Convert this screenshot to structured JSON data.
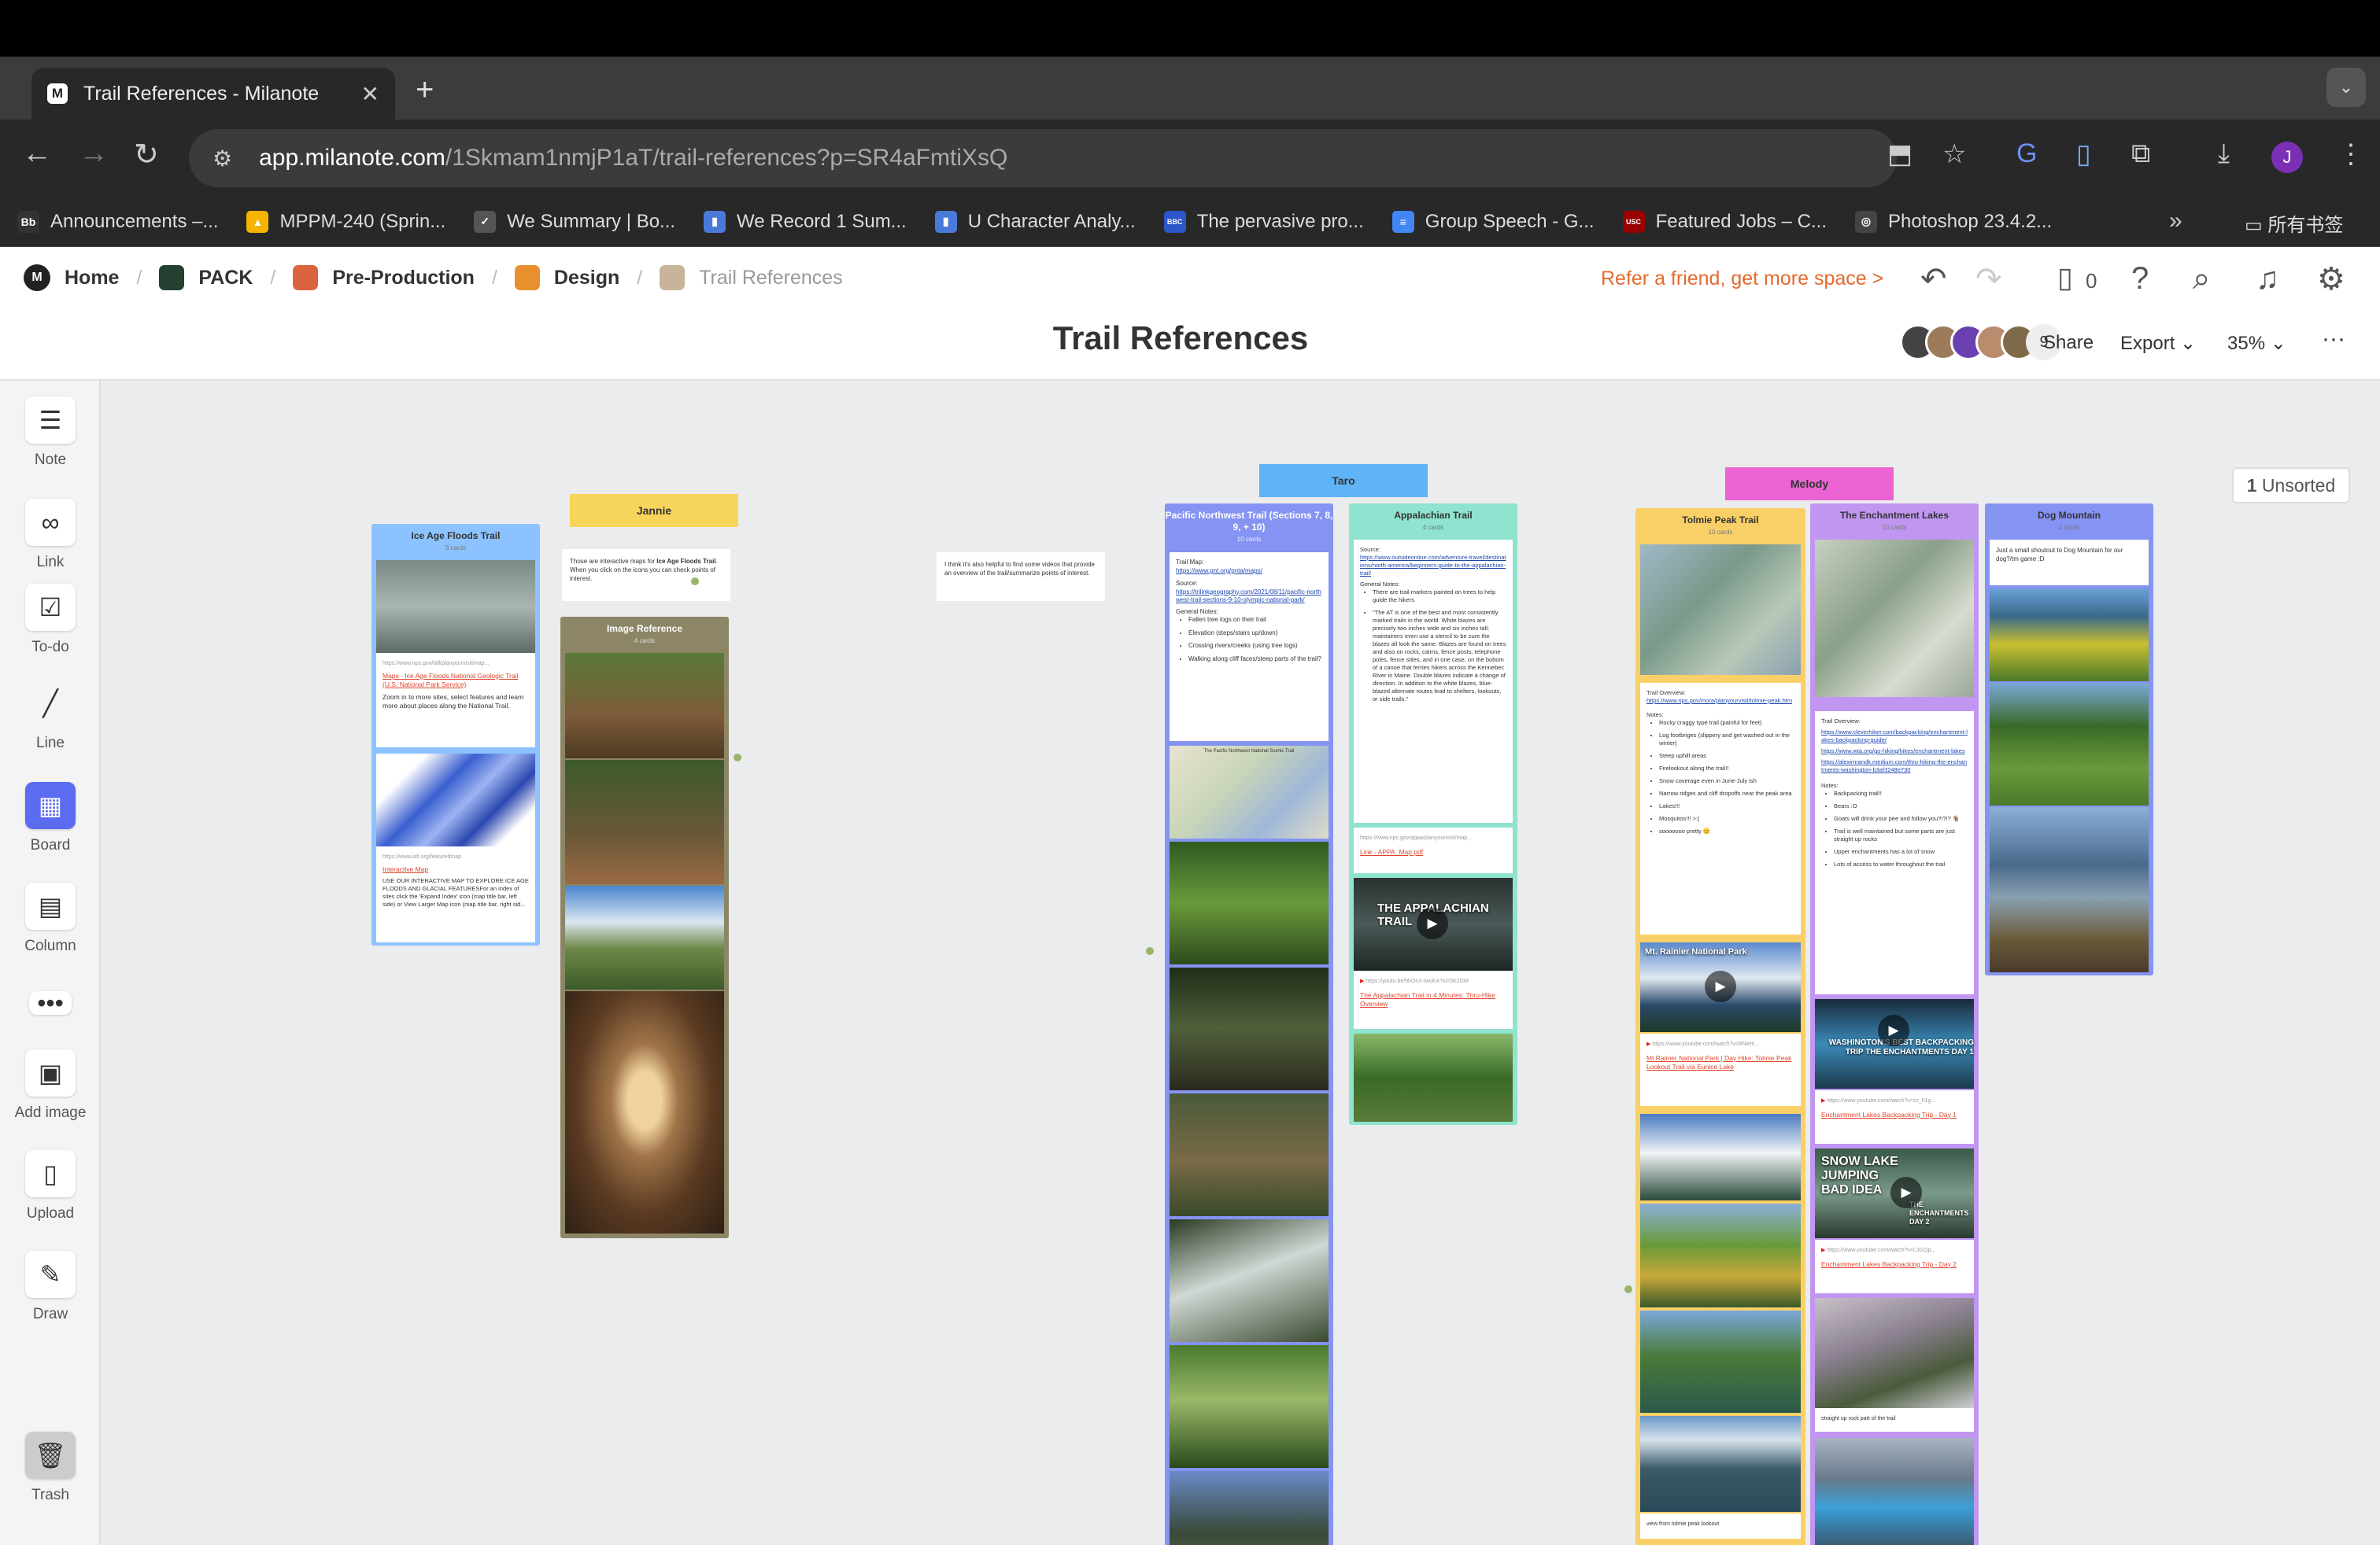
{
  "browser": {
    "tab_title": "Trail References - Milanote",
    "url_host": "app.milanote.com",
    "url_path": "/1Skmam1nmjP1aT/trail-references?p=SR4aFmtiXsQ",
    "profile_initial": "J",
    "bookmarks": [
      {
        "label": "Announcements –...",
        "icon": "Bb",
        "color": "#333333"
      },
      {
        "label": "MPPM-240 (Sprin...",
        "icon": "drive-icon",
        "color": "#f4b400"
      },
      {
        "label": "We Summary | Bo...",
        "icon": "check-icon",
        "color": "#555555"
      },
      {
        "label": "We Record 1 Sum...",
        "icon": "bars-icon",
        "color": "#4a7ad9"
      },
      {
        "label": "U Character Analy...",
        "icon": "bars-icon",
        "color": "#4a7ad9"
      },
      {
        "label": "The pervasive pro...",
        "icon": "BBC",
        "color": "#2c56c9"
      },
      {
        "label": "Group Speech - G...",
        "icon": "docs-icon",
        "color": "#4285f4"
      },
      {
        "label": "Featured Jobs – C...",
        "icon": "USC",
        "color": "#990000"
      },
      {
        "label": "Photoshop 23.4.2...",
        "icon": "globe-icon",
        "color": "#444444"
      }
    ],
    "bookmarks_folder": "所有书签"
  },
  "app": {
    "breadcrumbs": [
      {
        "label": "Home",
        "color": "#222222"
      },
      {
        "label": "PACK",
        "color": "#244030"
      },
      {
        "label": "Pre-Production",
        "color": "#d9643e"
      },
      {
        "label": "Design",
        "color": "#e8902e"
      },
      {
        "label": "Trail References",
        "color": "#c7b49b"
      }
    ],
    "refer": "Refer a friend, get more space >",
    "device_count": "0",
    "title": "Trail References",
    "collaborator_count": "9",
    "share": "Share",
    "export": "Export",
    "zoom": "35%",
    "unsorted_count": "1",
    "unsorted_label": "Unsorted"
  },
  "tools": [
    {
      "label": "Note"
    },
    {
      "label": "Link"
    },
    {
      "label": "To-do"
    },
    {
      "label": "Line"
    },
    {
      "label": "Board"
    },
    {
      "label": "Column"
    },
    {
      "label": "Add image"
    },
    {
      "label": "Upload"
    },
    {
      "label": "Draw"
    },
    {
      "label": "Trash"
    }
  ],
  "board": {
    "labels": {
      "jannie": "Jannie",
      "taro": "Taro",
      "melody": "Melody"
    },
    "ice_age": {
      "title": "Ice Age Floods Trail",
      "sub": "3 cards",
      "link1_url": "https://www.nps.gov/iafl/planyourvisit/map...",
      "link1_title": "Maps - Ice Age Floods National Geologic Trail (U.S. National Park Service)",
      "link1_desc": "Zoom in to more sites, select features and learn more about places along the National Trail.",
      "link2_url": "https://www.iafi.org/featuredmap",
      "link2_title": "Interactive Map",
      "link2_desc": "USE OUR INTERACTIVE MAP TO EXPLORE ICE AGE FLOODS AND GLACIAL FEATURESFor an index of sites click the 'Expand Index' icon (map title bar, left side) or View Larger Map icon (map title bar, right sid..."
    },
    "jannie_note": {
      "pre": "Those are interactive maps for ",
      "bold": "Ice Age Floods Trail",
      "post": ". When you click on the icons you can check points of interest."
    },
    "image_ref": {
      "title": "Image Reference",
      "sub": "4 cards"
    },
    "taro_note": "I think it's also helpful to find some videos that provide an overview of the trail/summarize points of interest.",
    "pnw": {
      "title": "Pacific Northwest Trail (Sections 7, 8, 9, + 10)",
      "sub": "10 cards",
      "trail_map": "Trail Map:",
      "trail_map_url": "https://www.pnt.org/pnta/maps/",
      "source": "Source:",
      "source_url": "https://trilinkgeography.com/2021/08/11/pacific-northwest-trail-sections-9-10-olympic-national-park/",
      "general": "General Notes:",
      "notes": [
        "Fallen tree logs on their trail",
        "Elevation (steps/stairs up/down)",
        "Crossing rivers/creeks (using tree logs)",
        "Walking along cliff faces/steep parts of the trail?"
      ],
      "map_title": "The Pacific Northwest National Scenic Trail"
    },
    "appalachian": {
      "title": "Appalachian Trail",
      "sub": "4 cards",
      "source": "Source:",
      "source_url": "https://www.outsideonline.com/adventure-travel/destinations/north-america/beginners-guide-to-the-appalachian-trail/",
      "general": "General Notes:",
      "notes": [
        "There are trail markers painted on trees to help guide the hikers",
        "\"The AT is one of the best and most consistently marked trails in the world. White blazes are precisely two inches wide and six inches tall; maintainers even use a stencil to be sure the blazes all look the same. Blazes are found on trees and also on rocks, cairns, fence posts, telephone poles, fence stiles, and in one case, on the bottom of a canoe that ferries hikers across the Kennebec River in Maine. Double blazes indicate a change of direction. In addition to the white blazes, blue-blazed alternate routes lead to shelters, lookouts, or side trails.\""
      ],
      "pdf_url": "https://www.nps.gov/appa/planyourvisit/map...",
      "pdf_title": "Link - APPA_Map.pdf",
      "video_text": "THE APPALACHIAN TRAIL",
      "video_url": "https://youtu.be/9hOnX-lwuEA?si=5K2l2M",
      "video_title": "The Appalachian Trail in 4 Minutes: Thru-Hike Overview"
    },
    "tolmie": {
      "title": "Tolmie Peak Trail",
      "sub": "10 cards",
      "overview": "Trail Overview:",
      "overview_url": "https://www.nps.gov/mora/planyourvisit/tolmie-peak.htm",
      "notes_label": "Notes:",
      "notes": [
        "Rocky craggy type trail (painful for feet)",
        "Log footbriges (slippery and get washed out in the winter)",
        "Steep uphill areas",
        "Firelookout along the trail!!",
        "Snow coverage even in June-July ish",
        "Narrow ridges and cliff dropoffs near the peak area",
        "Lakes!!!",
        "Mosquitos!!! >:(",
        "sooooooo pretty 😊"
      ],
      "video_text": "Mt. Rainier National Park",
      "video_url": "https://www.youtube.com/watch?v=Rf4em...",
      "video_title": "Mt Rainier National Park | Day Hike: Tolmie Peak Lookout Trail via Eunice Lake",
      "caption": "view from tolmie peak lookout"
    },
    "enchantment": {
      "title": "The Enchantment Lakes",
      "sub": "10 cards",
      "overview": "Trail Overview:",
      "urls": [
        "https://www.cleverhiker.com/backpacking/enchantment-lakes-backpacking-guide/",
        "https://www.wta.org/go-hiking/hikes/enchantment-lakes",
        "https://alexirmandk.medium.com/thru-hiking-the-enchantments-washington-b3af3248e730"
      ],
      "notes_label": "Notes:",
      "notes": [
        "Backpacking trail!!",
        "Bears :O",
        "Goats will drink your pee and follow you?!?!? 🐐",
        "Trail is well maintained but some parts are just straight up rocks",
        "Upper enchantments has a lot of snow",
        "Lots of access to water throughout the trail"
      ],
      "video1_text": "WASHINGTON'S BEST BACKPACKING TRIP THE ENCHANTMENTS DAY 1",
      "video1_url": "https://www.youtube.com/watch?v=zz_h1g...",
      "video1_title": "Enchantment Lakes Backpacking Trip - Day 1",
      "video2_text": "SNOW LAKE JUMPING BAD IDEA",
      "video2_badge": "THE ENCHANTMENTS DAY 2",
      "video2_url": "https://www.youtube.com/watch?v=L3GQp...",
      "video2_title": "Enchantment Lakes Backpacking Trip - Day 2",
      "caption": "straight up rock part of the trail"
    },
    "dog": {
      "title": "Dog Mountain",
      "sub": "4 cards",
      "note": "Just a small shoutout to Dog Mountain for our dog?/tm game :D"
    }
  },
  "colors": {
    "accent_orange": "#e56a2e",
    "ice_age": "#8cc2ff",
    "jannie": "#f7d45a",
    "taro": "#5fb4f7",
    "melody": "#ec64d4",
    "image_ref": "#8c8666",
    "pnw": "#8593f2",
    "appalachian": "#8fe3cf",
    "tolmie": "#f9d067",
    "enchantment": "#c196f1",
    "dog": "#8593f2"
  }
}
